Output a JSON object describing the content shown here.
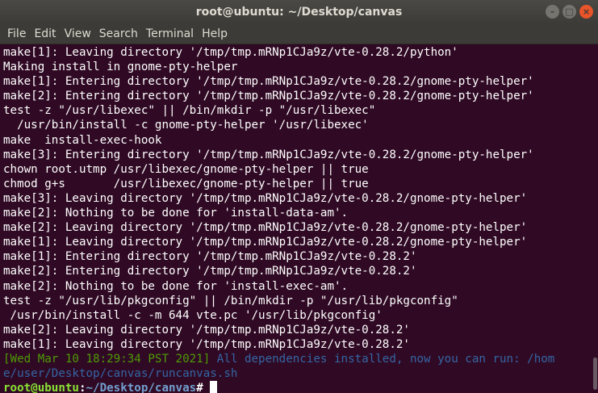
{
  "window": {
    "title": "root@ubuntu: ~/Desktop/canvas",
    "buttons": [
      "–",
      "□",
      "×"
    ]
  },
  "menu": [
    "File",
    "Edit",
    "View",
    "Search",
    "Terminal",
    "Help"
  ],
  "terminal": {
    "lines": [
      "make[1]: Leaving directory '/tmp/tmp.mRNp1CJa9z/vte-0.28.2/python'",
      "Making install in gnome-pty-helper",
      "make[1]: Entering directory '/tmp/tmp.mRNp1CJa9z/vte-0.28.2/gnome-pty-helper'",
      "make[2]: Entering directory '/tmp/tmp.mRNp1CJa9z/vte-0.28.2/gnome-pty-helper'",
      "test -z \"/usr/libexec\" || /bin/mkdir -p \"/usr/libexec\"",
      "  /usr/bin/install -c gnome-pty-helper '/usr/libexec'",
      "make  install-exec-hook",
      "make[3]: Entering directory '/tmp/tmp.mRNp1CJa9z/vte-0.28.2/gnome-pty-helper'",
      "chown root.utmp /usr/libexec/gnome-pty-helper || true",
      "chmod g+s       /usr/libexec/gnome-pty-helper || true",
      "make[3]: Leaving directory '/tmp/tmp.mRNp1CJa9z/vte-0.28.2/gnome-pty-helper'",
      "make[2]: Nothing to be done for 'install-data-am'.",
      "make[2]: Leaving directory '/tmp/tmp.mRNp1CJa9z/vte-0.28.2/gnome-pty-helper'",
      "make[1]: Leaving directory '/tmp/tmp.mRNp1CJa9z/vte-0.28.2/gnome-pty-helper'",
      "make[1]: Entering directory '/tmp/tmp.mRNp1CJa9z/vte-0.28.2'",
      "make[2]: Entering directory '/tmp/tmp.mRNp1CJa9z/vte-0.28.2'",
      "make[2]: Nothing to be done for 'install-exec-am'.",
      "test -z \"/usr/lib/pkgconfig\" || /bin/mkdir -p \"/usr/lib/pkgconfig\"",
      " /usr/bin/install -c -m 644 vte.pc '/usr/lib/pkgconfig'",
      "make[2]: Leaving directory '/tmp/tmp.mRNp1CJa9z/vte-0.28.2'",
      "make[1]: Leaving directory '/tmp/tmp.mRNp1CJa9z/vte-0.28.2'"
    ],
    "status_timestamp": "[Wed Mar 10 18:29:34 PST 2021]",
    "status_message_1": " All dependencies installed, now you can run: /hom",
    "status_message_2": "e/user/Desktop/canvas/runcanvas.sh",
    "prompt_user": "root@ubuntu",
    "prompt_colon": ":",
    "prompt_path": "~/Desktop/canvas",
    "prompt_symbol": "# "
  },
  "colors": {
    "background": "#300a24",
    "timestamp": "#4e9a06",
    "message": "#3465a4",
    "prompt_user": "#8ae234",
    "prompt_path": "#729fcf"
  }
}
